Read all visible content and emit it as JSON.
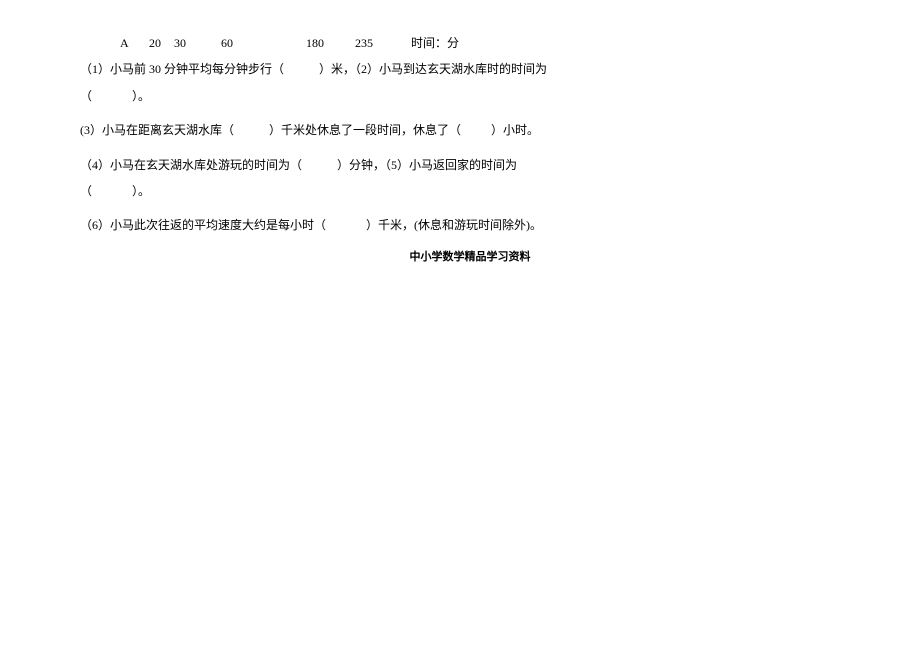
{
  "axis": {
    "label_A": "A",
    "v1": "20",
    "v2": "30",
    "v3": "60",
    "v4": "180",
    "v5": "235",
    "unit_label": "时间：分"
  },
  "q1": {
    "prefix": "（1）小马前 30 分钟平均每分钟步行（",
    "after_blank1": "）米，（2）小马到达玄天湖水库时的时间为"
  },
  "q1_line2": {
    "open": "（",
    "close": "）。"
  },
  "q3": {
    "text_a": "(3）小马在距离玄天湖水库（",
    "text_b": "）千米处休息了一段时间，休息了（",
    "text_c": "）小时。"
  },
  "q4": {
    "text_a": "（4）小马在玄天湖水库处游玩的时间为（",
    "text_b": "）分钟，（5）小马返回家的时间为"
  },
  "q4_line2": {
    "open": "（",
    "close": "）。"
  },
  "q6": {
    "text_a": "（6）小马此次往返的平均速度大约是每小时（",
    "text_b": "）千米，(休息和游玩时间除外)。"
  },
  "footer": "中小学数学精品学习资料"
}
